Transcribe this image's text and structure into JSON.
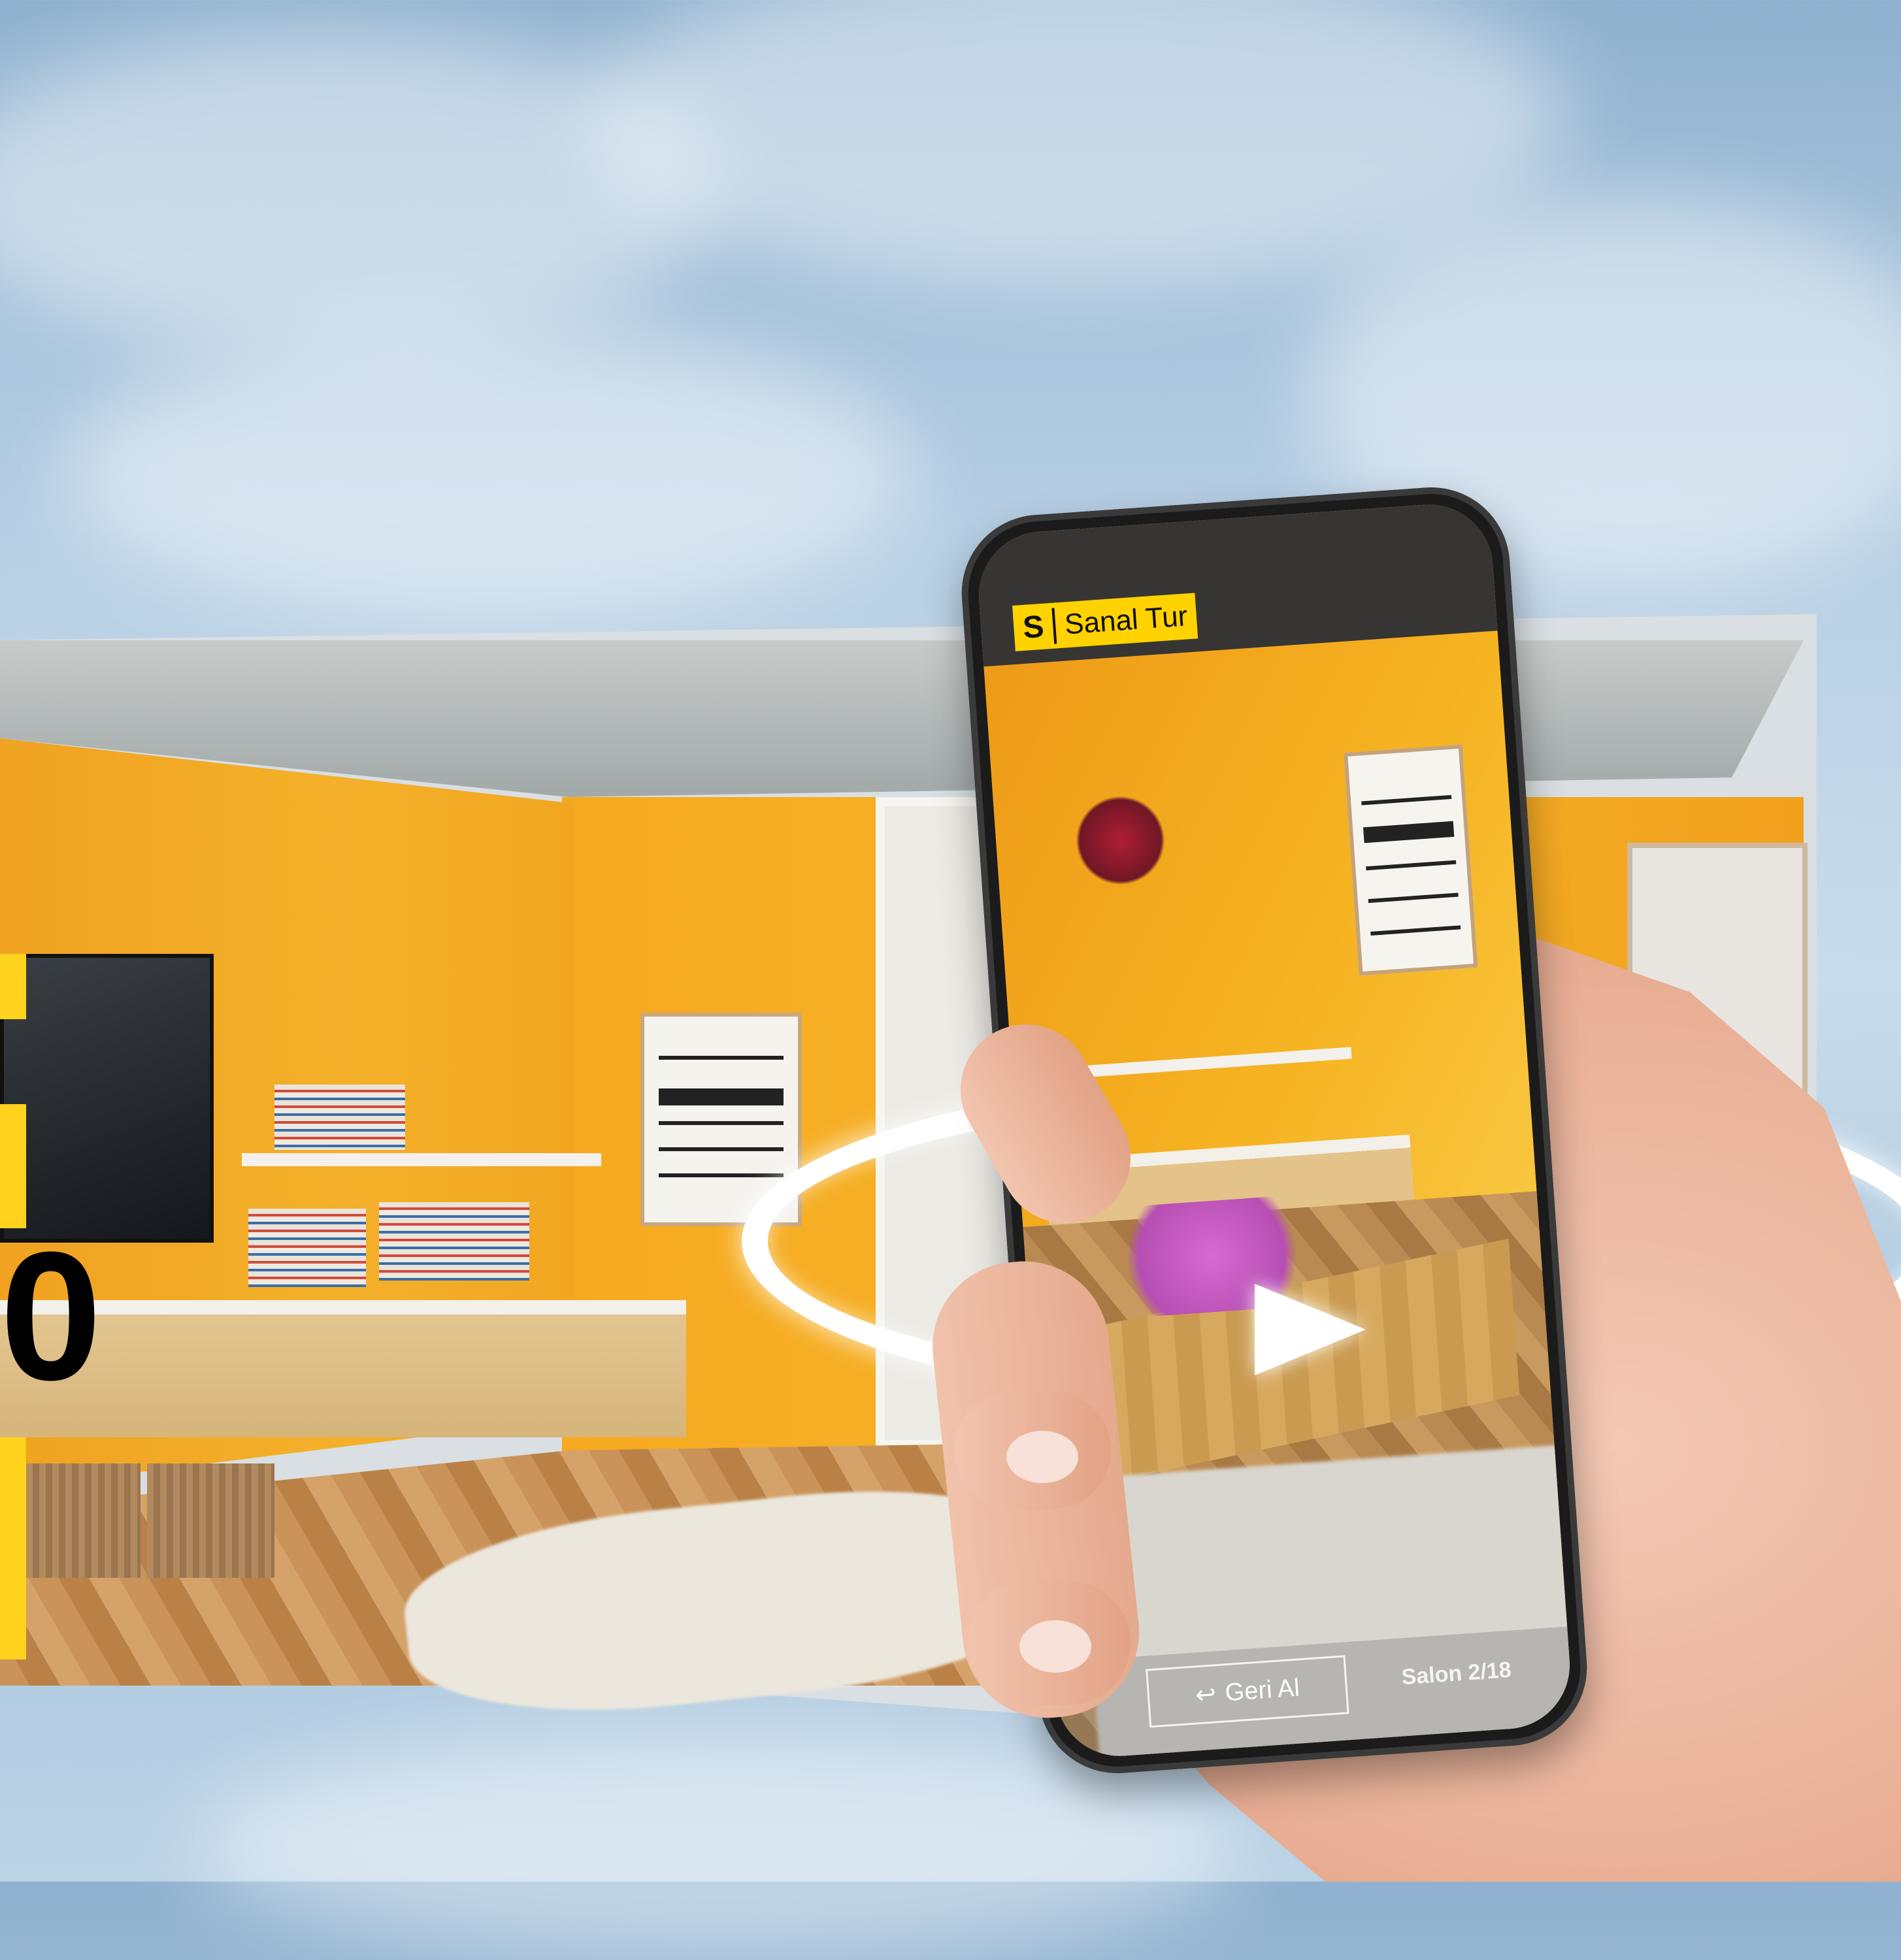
{
  "app": {
    "logo_letter": "S",
    "logo_text": "Sanal Tur",
    "brand_color": "#ffd200"
  },
  "controls": {
    "back_icon": "undo-arrow-icon",
    "back_label": "Geri Al",
    "room_indicator": "Salon 2/18"
  },
  "overlay": {
    "rotate_icon": "rotate-360-icon",
    "left_fragment_text": "0"
  }
}
